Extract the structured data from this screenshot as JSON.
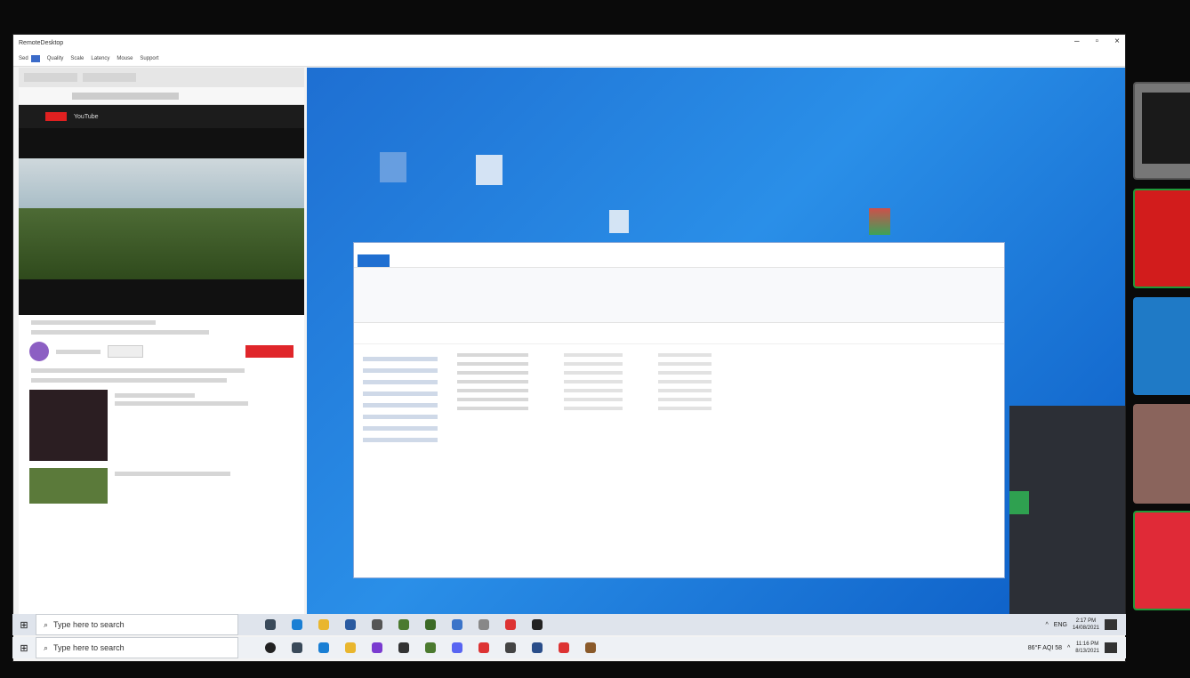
{
  "rd_window": {
    "title": "RemoteDesktop",
    "controls": [
      "–",
      "▫",
      "×"
    ],
    "toolbar": [
      "Sed",
      "Quality",
      "Scale",
      "Latency",
      "Mouse",
      "Support"
    ]
  },
  "browser": {
    "site": "YouTube"
  },
  "taskbar_remote": {
    "search_placeholder": "Type here to search",
    "lang": "ENG",
    "time": "2:17 PM",
    "date": "14/08/2021"
  },
  "taskbar_local": {
    "search_placeholder": "Type here to search",
    "weather": "86°F AQI 58",
    "time": "11:16 PM",
    "date": "8/13/2021"
  },
  "icons": {
    "start": "windows-start-icon",
    "search": "search-icon"
  },
  "colors": {
    "desktop_blue": "#1e6fd2",
    "explorer_accent": "#1f6fd1",
    "yt_red": "#e02020",
    "tile_red": "#d21c1c",
    "tile_blue": "#1f7ac6",
    "tile_brown": "#8a645c",
    "tile_crimson": "#e02a37"
  }
}
